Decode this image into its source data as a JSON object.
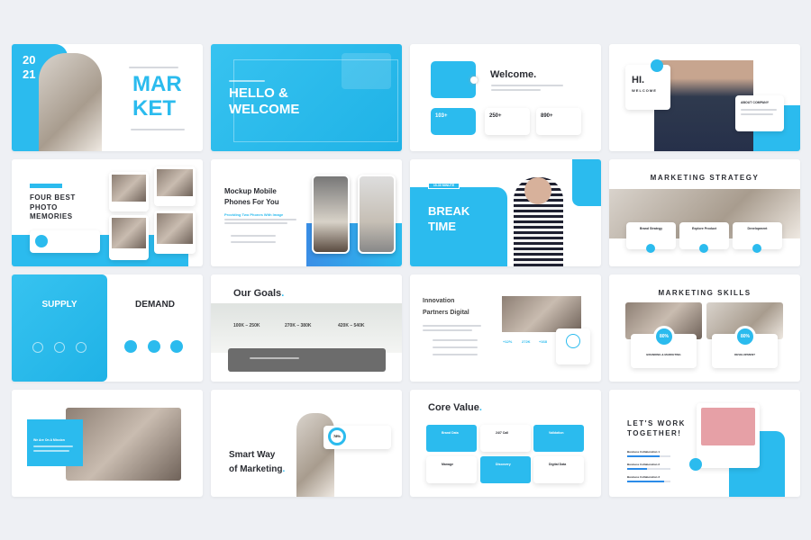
{
  "accent": "#2bbbee",
  "s1": {
    "year_a": "20",
    "year_b": "21",
    "title_a": "MAR",
    "title_b": "KET"
  },
  "s2": {
    "title_a": "HELLO &",
    "title_b": "WELCOME"
  },
  "s3": {
    "title": "Welcome.",
    "stats": [
      "103+",
      "250+",
      "890+"
    ]
  },
  "s4": {
    "title": "HI.",
    "subtitle": "WELCOME",
    "card_title": "ABOUT COMPANY"
  },
  "s5": {
    "lines": [
      "FOUR BEST",
      "PHOTO",
      "MEMORIES"
    ]
  },
  "s6": {
    "title_a": "Mockup Mobile",
    "title_b": "Phones For You",
    "subtitle": "Providing Two Phones With Image"
  },
  "s7": {
    "badge": "15-30 MINUTE",
    "title_a": "BREAK",
    "title_b": "TIME"
  },
  "s8": {
    "title": "MARKETING STRATEGY",
    "cards": [
      "Brand Strategy",
      "Explore Product",
      "Development"
    ]
  },
  "s9": {
    "left": "SUPPLY",
    "right": "DEMAND"
  },
  "s10": {
    "title": "Our Goals",
    "ranges": [
      "100K – 250K",
      "270K – 380K",
      "420K – 540K"
    ]
  },
  "s11": {
    "title_a": "Innovation",
    "title_b": "Partners Digital",
    "stats": [
      "+12%",
      "272K",
      "+168"
    ]
  },
  "s12": {
    "title": "MARKETING SKILLS",
    "skills": [
      {
        "label": "BRANDING & MARKETING",
        "value": "80%"
      },
      {
        "label": "DEVELOPMENT",
        "value": "80%"
      }
    ]
  },
  "s13": {
    "title": "We Are On A Mission"
  },
  "s14": {
    "title_a": "Smart Way",
    "title_b": "of Marketing",
    "percent": "78%"
  },
  "s15": {
    "title": "Core Value",
    "cards": [
      "Brand Data",
      "24/7 Call",
      "Validation",
      "Manage",
      "Discovery",
      "Digital Data"
    ]
  },
  "s16": {
    "title_a": "LET'S WORK",
    "title_b": "TOGETHER!",
    "bars": [
      {
        "label": "Business Collaboration 1",
        "value": 0.75
      },
      {
        "label": "Business Collaboration 2",
        "value": 0.45
      },
      {
        "label": "Business Collaboration 3",
        "value": 0.85
      }
    ]
  }
}
